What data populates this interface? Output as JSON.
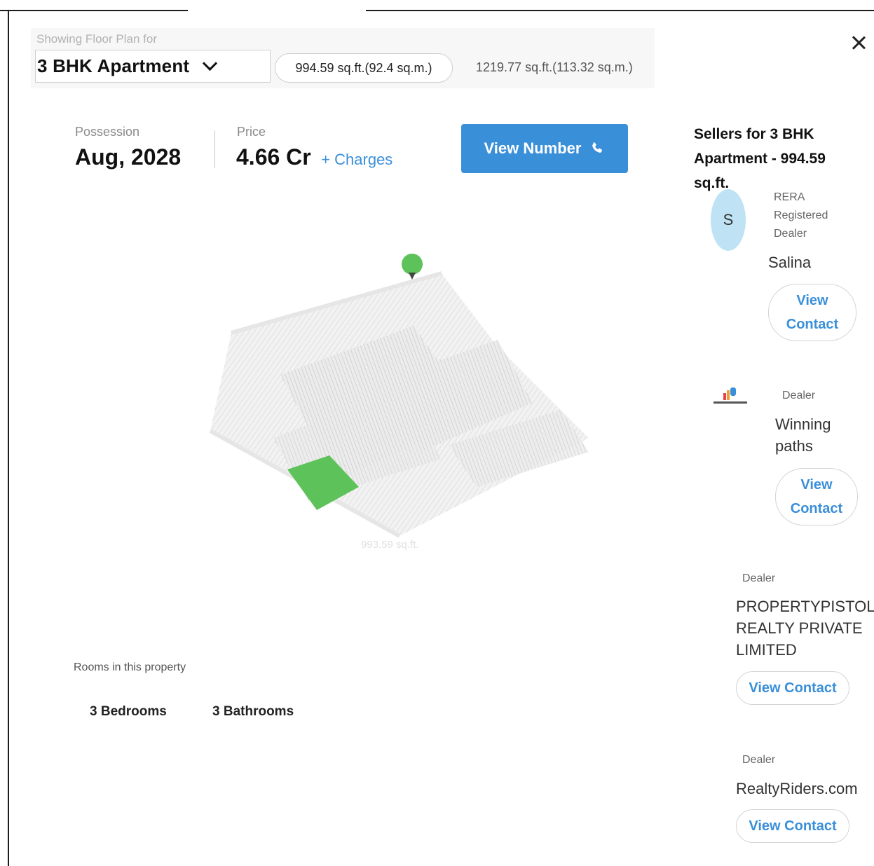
{
  "header": {
    "showing_label": "Showing Floor Plan for",
    "selected_config": "3 BHK Apartment",
    "area_selected": "994.59 sq.ft.(92.4 sq.m.)",
    "area_alternate": "1219.77 sq.ft.(113.32 sq.m.)"
  },
  "summary": {
    "possession_label": "Possession",
    "possession_value": "Aug, 2028",
    "price_label": "Price",
    "price_value": "4.66 Cr",
    "charges_link": "+ Charges",
    "view_number_label": "View Number"
  },
  "floorplan": {
    "caption": "993.59 sq.ft."
  },
  "rooms": {
    "label": "Rooms in this property",
    "bedrooms": "3 Bedrooms",
    "bathrooms": "3 Bathrooms"
  },
  "sellers": {
    "title": "Sellers for 3 BHK Apartment - 994.59 sq.ft.",
    "items": [
      {
        "avatar_letter": "S",
        "tag": "RERA Registered Dealer",
        "name": "Salina",
        "contact_label": "View\nContact"
      },
      {
        "tag": "Dealer",
        "name": "Winning paths",
        "contact_label": "View\nContact"
      },
      {
        "tag": "Dealer",
        "name": "PROPERTYPISTOL REALTY PRIVATE LIMITED",
        "contact_label": "View Contact"
      },
      {
        "tag": "Dealer",
        "name": "RealtyRiders.com",
        "contact_label": "View Contact"
      }
    ]
  },
  "colors": {
    "accent": "#3a8fd9",
    "highlight": "#5ec25a",
    "avatar_bg": "#bfe3f4"
  },
  "icons": {
    "close": "close-icon",
    "dropdown": "chevron-down-icon",
    "phone": "phone-icon",
    "location": "location-pin-icon"
  }
}
